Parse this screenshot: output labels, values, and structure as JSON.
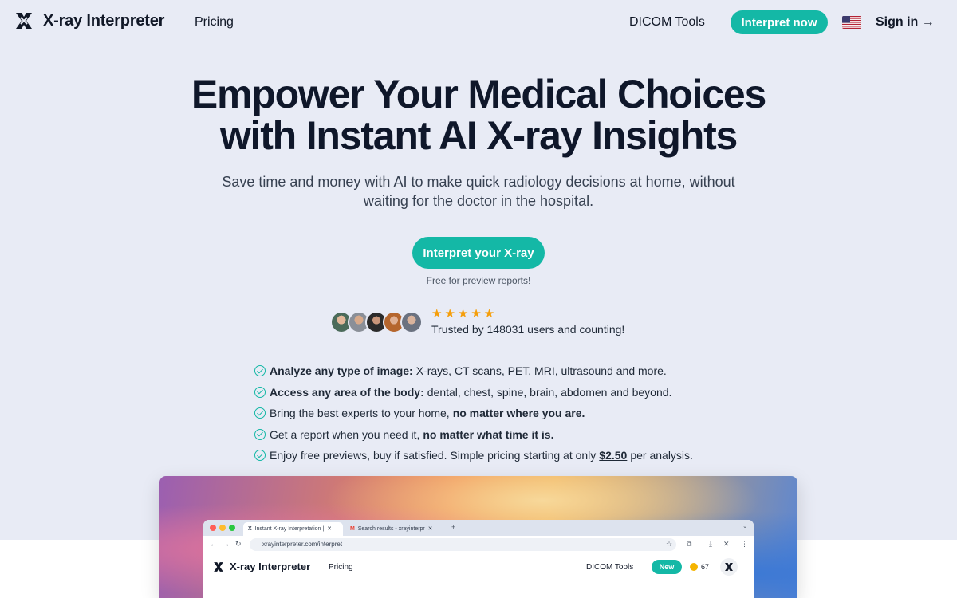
{
  "nav": {
    "brand": "X-ray Interpreter",
    "links": [
      "Pricing",
      "DICOM Tools"
    ],
    "cta": "Interpret now",
    "language_flag": "us-flag-icon",
    "signin": "Sign in →"
  },
  "hero": {
    "title_line1": "Empower Your Medical Choices",
    "title_line2": "with Instant AI X-ray Insights",
    "subtitle": "Save time and money with AI to make quick radiology decisions at home, without waiting for the doctor in the hospital.",
    "cta": "Interpret your X-ray",
    "note": "Free for preview reports!"
  },
  "trust": {
    "rating_stars": 5,
    "stars_text": "★★★★★",
    "text": "Trusted by 148031 users and counting!"
  },
  "features": [
    {
      "bold": "Analyze any type of image:",
      "text": "X-rays, CT scans, PET, MRI, ultrasound and more."
    },
    {
      "bold": "Access any area of the body:",
      "text": "dental, chest, spine, brain, abdomen and beyond."
    },
    {
      "text": "Bring the best experts to your home,",
      "bold": "no matter where you are."
    },
    {
      "text": "Get a report when you need it,",
      "bold": "no matter what time it is."
    },
    {
      "text": "Enjoy free previews, buy if satisfied. Simple pricing starting at only",
      "price": "$2.50",
      "tail": "per analysis."
    }
  ],
  "screenshot": {
    "tab1": "Instant X-ray Interpretation |",
    "tab2": "Search results - xrayinterpr",
    "url": "xrayinterpreter.com/interpret",
    "brand": "X-ray Interpreter",
    "pricing": "Pricing",
    "dicom": "DICOM Tools",
    "badge": "New",
    "credits": "67"
  },
  "colors": {
    "accent": "#14b8a6",
    "background": "#e8ebf5",
    "heading": "#0f172a",
    "star": "#f59e0b"
  }
}
